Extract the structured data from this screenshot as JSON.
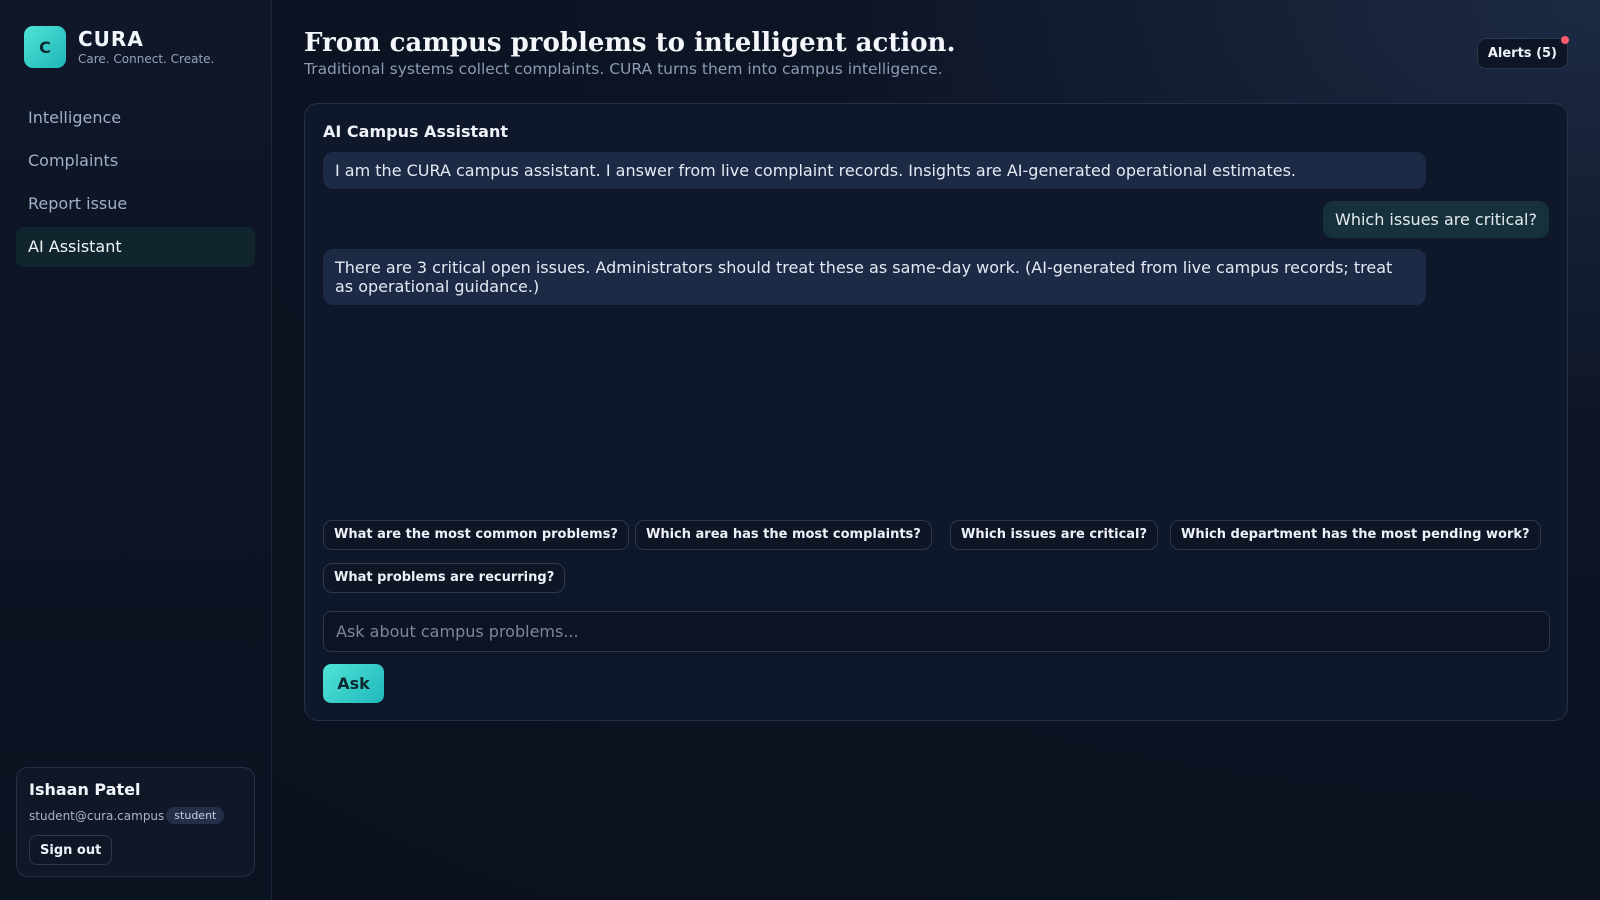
{
  "brand": {
    "logo_letter": "C",
    "name": "CURA",
    "tagline": "Care. Connect. Create."
  },
  "nav": {
    "items": [
      {
        "label": "Intelligence",
        "active": false
      },
      {
        "label": "Complaints",
        "active": false
      },
      {
        "label": "Report issue",
        "active": false
      },
      {
        "label": "AI Assistant",
        "active": true
      }
    ]
  },
  "user": {
    "name": "Ishaan Patel",
    "email": "student@cura.campus",
    "role": "student",
    "signout_label": "Sign out"
  },
  "header": {
    "title": "From campus problems to intelligent action.",
    "subtitle": "Traditional systems collect complaints. CURA turns them into campus intelligence.",
    "alerts_label": "Alerts (5)"
  },
  "assistant": {
    "title": "AI Campus Assistant",
    "messages": [
      {
        "role": "assistant",
        "text": "I am the CURA campus assistant. I answer from live complaint records. Insights are AI-generated operational estimates."
      },
      {
        "role": "user",
        "text": "Which issues are critical?"
      },
      {
        "role": "assistant",
        "text": "There are 3 critical open issues. Administrators should treat these as same-day work. (AI-generated from live campus records; treat as operational guidance.)"
      }
    ],
    "suggestions": [
      "What are the most common problems?",
      "Which area has the most complaints?",
      "Which issues are critical?",
      "Which department has the most pending work?",
      "What problems are recurring?"
    ],
    "input_placeholder": "Ask about campus problems...",
    "input_value": "",
    "ask_label": "Ask"
  },
  "colors": {
    "accent": "#2fd0c9",
    "alert_dot": "#ff5a6e",
    "background": "#0b1220"
  }
}
